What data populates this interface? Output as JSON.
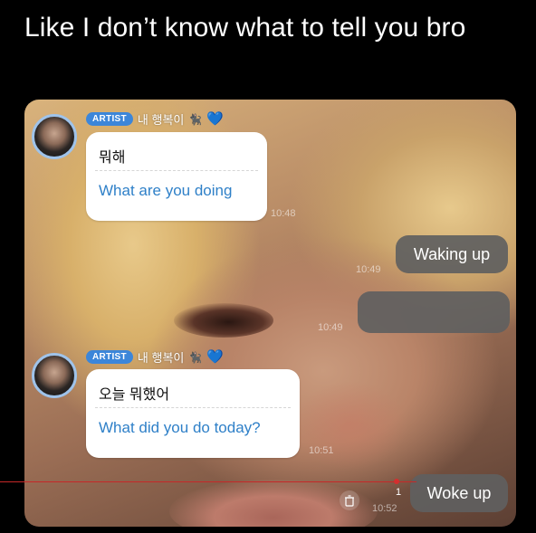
{
  "caption": "Like I don’t know what to tell you bro",
  "artist": {
    "badge": "ARTIST",
    "name": "내 행복이",
    "emoji": "🐈‍⬛",
    "heart": "💙"
  },
  "messages": [
    {
      "korean": "뭐해",
      "english": "What are you doing",
      "time": "10:48"
    },
    {
      "text": "Waking up",
      "time": "10:49"
    },
    {
      "text": "",
      "time": "10:49"
    },
    {
      "korean": "오늘 뭐했어",
      "english": "What did you do today?",
      "time": "10:51"
    },
    {
      "text": "Woke up",
      "time": "10:52",
      "unread": "1"
    }
  ],
  "icons": {
    "trash": "trash-icon"
  }
}
